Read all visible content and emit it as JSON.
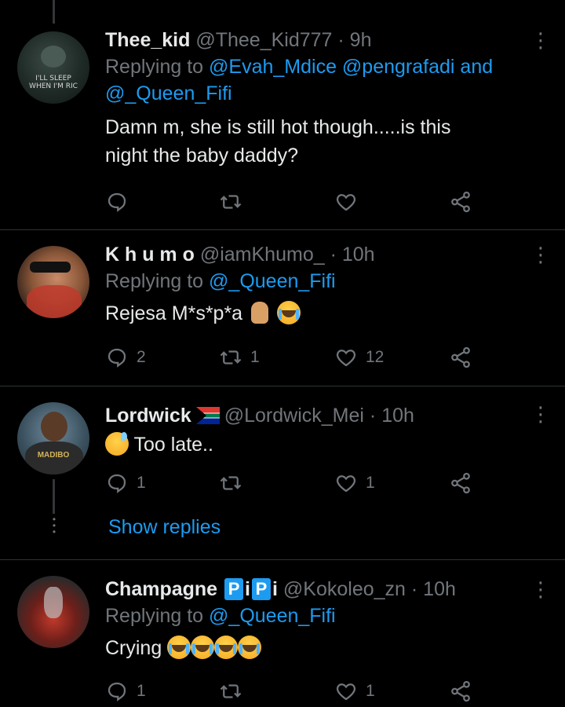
{
  "tweets": [
    {
      "name": "Thee_kid",
      "handle": "@Thee_Kid777",
      "sep": "·",
      "time": "9h",
      "reply_prefix": "Replying to",
      "reply_mentions_1": "@Evah_Mdice @pengrafadi",
      "reply_and": "and",
      "reply_mentions_2": "@_Queen_Fifi",
      "body_1": "Damn m, she is still hot though.....is this",
      "body_2": "night the baby daddy?",
      "avatar_text_1": "I'LL SLEEP",
      "avatar_text_2": "WHEN I'M RIC",
      "reply_count": "",
      "retweet_count": "",
      "like_count": ""
    },
    {
      "name": "K h u m o",
      "handle": "@iamKhumo_",
      "sep": "·",
      "time": "10h",
      "reply_prefix": "Replying to",
      "reply_mentions": "@_Queen_Fifi",
      "body": "Rejesa M*s*p*a",
      "reply_count": "2",
      "retweet_count": "1",
      "like_count": "12"
    },
    {
      "name": "Lordwick",
      "handle": "@Lordwick_Mei",
      "sep": "·",
      "time": "10h",
      "body": "Too late..",
      "avatar_text": "MADIBO",
      "reply_count": "1",
      "retweet_count": "",
      "like_count": "1"
    },
    {
      "name_prefix": "Champagne",
      "name_p1": "P",
      "name_i": "i",
      "name_p2": "P",
      "name_i2": "i",
      "handle": "@Kokoleo_zn",
      "sep": "·",
      "time": "10h",
      "reply_prefix": "Replying to",
      "reply_mentions": "@_Queen_Fifi",
      "body": "Crying",
      "reply_count": "1",
      "retweet_count": "",
      "like_count": "1"
    }
  ],
  "show_replies": "Show replies",
  "colors": {
    "background": "#000000",
    "text": "#e7e9ea",
    "muted": "#71767b",
    "accent": "#1d9bf0",
    "divider": "#2f3336"
  },
  "icons": [
    "more-icon",
    "reply-icon",
    "retweet-icon",
    "like-icon",
    "share-icon",
    "sa-flag-icon",
    "crying-emoji-icon",
    "sweat-smile-emoji-icon",
    "crossed-fingers-emoji-icon"
  ]
}
